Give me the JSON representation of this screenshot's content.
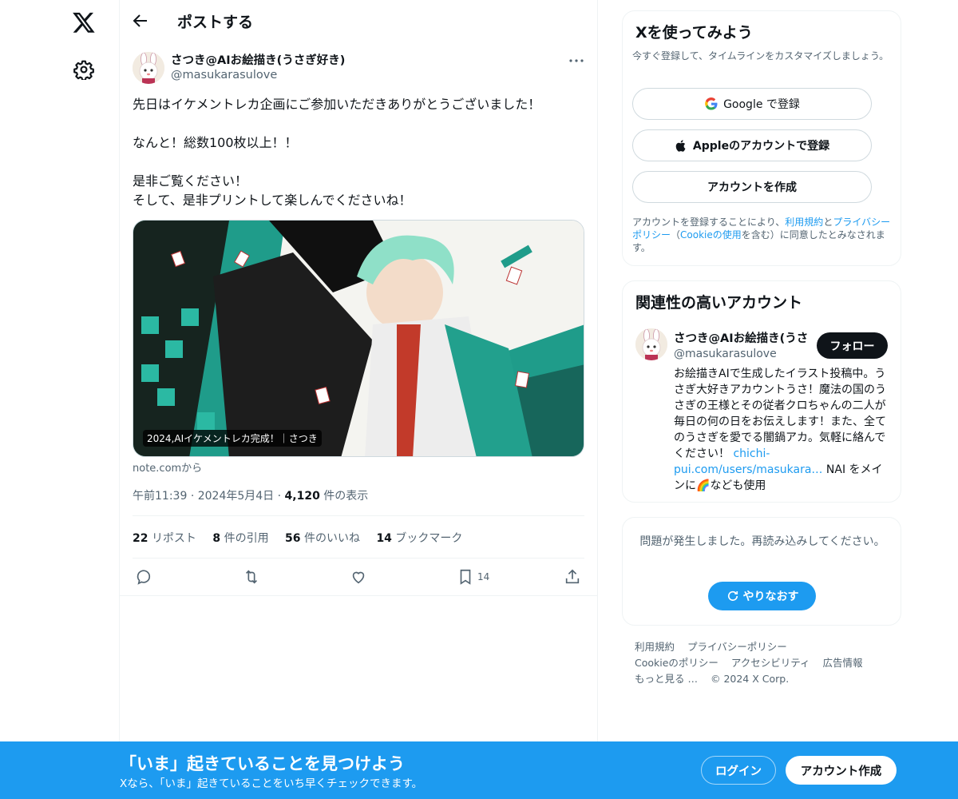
{
  "nav": {
    "logo_icon": "x-logo-icon",
    "settings_icon": "gear-icon"
  },
  "header": {
    "back_icon": "arrow-left-icon",
    "title": "ポストする"
  },
  "tweet": {
    "author_name": "さつき@AIお絵描き(うさぎ好き)",
    "author_handle": "@masukarasulove",
    "lines": [
      "先日はイケメントレカ企画にご参加いただきありがとうございました！",
      "",
      "なんと！総数100枚以上！！",
      "",
      "是非ご覧ください！",
      "そして、是非プリントして楽しんでくださいね！"
    ],
    "card_caption": "2024,AIイケメントレカ完成！｜さつき",
    "source": "note.comから",
    "time": "午前11:39",
    "date": "2024年5月4日",
    "views_count": "4,120",
    "views_label": "件の表示",
    "stats": [
      {
        "count": "22",
        "label": "リポスト"
      },
      {
        "count": "8",
        "label": "件の引用"
      },
      {
        "count": "56",
        "label": "件のいいね"
      },
      {
        "count": "14",
        "label": "ブックマーク"
      }
    ],
    "bookmark_count": "14"
  },
  "signup_panel": {
    "title": "Xを使ってみよう",
    "subtitle": "今すぐ登録して、タイムラインをカスタマイズしましょう。",
    "google_label": "Google で登録",
    "apple_label": "Appleのアカウントで登録",
    "create_label": "アカウントを作成",
    "terms_pre": "アカウントを登録することにより、",
    "terms_link": "利用規約",
    "terms_and": "と",
    "privacy_link": "プライバシーポリシー",
    "cookie_open": "（",
    "cookie_link": "Cookieの使用",
    "cookie_post": "を含む）に同意したとみなされます。"
  },
  "related_panel": {
    "title": "関連性の高いアカウント",
    "name": "さつき@AIお絵描き(うさ",
    "handle": "@masukarasulove",
    "follow_label": "フォロー",
    "bio": "お絵描きAIで生成したイラスト投稿中。うさぎ大好きアカウントうさ！魔法の国のうさぎの王様とその従者クロちゃんの二人が毎日の何の日をお伝えします！また、全てのうさぎを愛でる闇鍋アカ。気軽に絡んでください！",
    "bio_link": "chichi-pui.com/users/masukara…",
    "bio_tail_1": " NAI",
    "bio_tail_2": "をメインに",
    "bio_tail_emoji": "🌈",
    "bio_tail_3": "なども使用"
  },
  "error_panel": {
    "message": "問題が発生しました。再読み込みしてください。",
    "retry_label": "やりなおす"
  },
  "footer": {
    "links": [
      "利用規約",
      "プライバシーポリシー",
      "Cookieのポリシー",
      "アクセシビリティ",
      "広告情報",
      "もっと見る …",
      "© 2024 X Corp."
    ]
  },
  "banner": {
    "title": "「いま」起きていることを見つけよう",
    "subtitle": "Xなら、「いま」起きていることをいち早くチェックできます。",
    "login_label": "ログイン",
    "signup_label": "アカウント作成"
  },
  "colors": {
    "accent": "#1d9bf0",
    "text": "#0f1419",
    "muted": "#536471",
    "border": "#eff3f4"
  }
}
